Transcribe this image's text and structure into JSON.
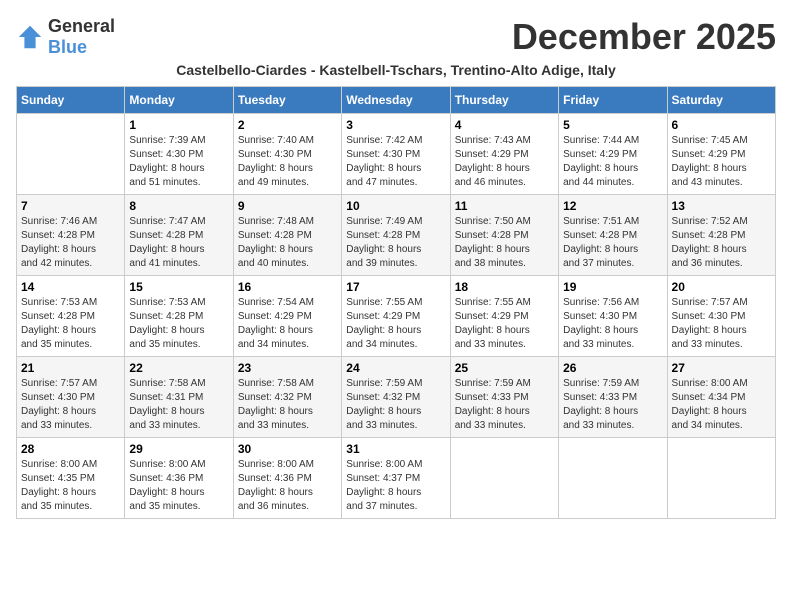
{
  "logo": {
    "general": "General",
    "blue": "Blue"
  },
  "title": "December 2025",
  "subtitle": "Castelbello-Ciardes - Kastelbell-Tschars, Trentino-Alto Adige, Italy",
  "days_of_week": [
    "Sunday",
    "Monday",
    "Tuesday",
    "Wednesday",
    "Thursday",
    "Friday",
    "Saturday"
  ],
  "weeks": [
    [
      {
        "day": "",
        "info": ""
      },
      {
        "day": "1",
        "info": "Sunrise: 7:39 AM\nSunset: 4:30 PM\nDaylight: 8 hours\nand 51 minutes."
      },
      {
        "day": "2",
        "info": "Sunrise: 7:40 AM\nSunset: 4:30 PM\nDaylight: 8 hours\nand 49 minutes."
      },
      {
        "day": "3",
        "info": "Sunrise: 7:42 AM\nSunset: 4:30 PM\nDaylight: 8 hours\nand 47 minutes."
      },
      {
        "day": "4",
        "info": "Sunrise: 7:43 AM\nSunset: 4:29 PM\nDaylight: 8 hours\nand 46 minutes."
      },
      {
        "day": "5",
        "info": "Sunrise: 7:44 AM\nSunset: 4:29 PM\nDaylight: 8 hours\nand 44 minutes."
      },
      {
        "day": "6",
        "info": "Sunrise: 7:45 AM\nSunset: 4:29 PM\nDaylight: 8 hours\nand 43 minutes."
      }
    ],
    [
      {
        "day": "7",
        "info": "Sunrise: 7:46 AM\nSunset: 4:28 PM\nDaylight: 8 hours\nand 42 minutes."
      },
      {
        "day": "8",
        "info": "Sunrise: 7:47 AM\nSunset: 4:28 PM\nDaylight: 8 hours\nand 41 minutes."
      },
      {
        "day": "9",
        "info": "Sunrise: 7:48 AM\nSunset: 4:28 PM\nDaylight: 8 hours\nand 40 minutes."
      },
      {
        "day": "10",
        "info": "Sunrise: 7:49 AM\nSunset: 4:28 PM\nDaylight: 8 hours\nand 39 minutes."
      },
      {
        "day": "11",
        "info": "Sunrise: 7:50 AM\nSunset: 4:28 PM\nDaylight: 8 hours\nand 38 minutes."
      },
      {
        "day": "12",
        "info": "Sunrise: 7:51 AM\nSunset: 4:28 PM\nDaylight: 8 hours\nand 37 minutes."
      },
      {
        "day": "13",
        "info": "Sunrise: 7:52 AM\nSunset: 4:28 PM\nDaylight: 8 hours\nand 36 minutes."
      }
    ],
    [
      {
        "day": "14",
        "info": "Sunrise: 7:53 AM\nSunset: 4:28 PM\nDaylight: 8 hours\nand 35 minutes."
      },
      {
        "day": "15",
        "info": "Sunrise: 7:53 AM\nSunset: 4:28 PM\nDaylight: 8 hours\nand 35 minutes."
      },
      {
        "day": "16",
        "info": "Sunrise: 7:54 AM\nSunset: 4:29 PM\nDaylight: 8 hours\nand 34 minutes."
      },
      {
        "day": "17",
        "info": "Sunrise: 7:55 AM\nSunset: 4:29 PM\nDaylight: 8 hours\nand 34 minutes."
      },
      {
        "day": "18",
        "info": "Sunrise: 7:55 AM\nSunset: 4:29 PM\nDaylight: 8 hours\nand 33 minutes."
      },
      {
        "day": "19",
        "info": "Sunrise: 7:56 AM\nSunset: 4:30 PM\nDaylight: 8 hours\nand 33 minutes."
      },
      {
        "day": "20",
        "info": "Sunrise: 7:57 AM\nSunset: 4:30 PM\nDaylight: 8 hours\nand 33 minutes."
      }
    ],
    [
      {
        "day": "21",
        "info": "Sunrise: 7:57 AM\nSunset: 4:30 PM\nDaylight: 8 hours\nand 33 minutes."
      },
      {
        "day": "22",
        "info": "Sunrise: 7:58 AM\nSunset: 4:31 PM\nDaylight: 8 hours\nand 33 minutes."
      },
      {
        "day": "23",
        "info": "Sunrise: 7:58 AM\nSunset: 4:32 PM\nDaylight: 8 hours\nand 33 minutes."
      },
      {
        "day": "24",
        "info": "Sunrise: 7:59 AM\nSunset: 4:32 PM\nDaylight: 8 hours\nand 33 minutes."
      },
      {
        "day": "25",
        "info": "Sunrise: 7:59 AM\nSunset: 4:33 PM\nDaylight: 8 hours\nand 33 minutes."
      },
      {
        "day": "26",
        "info": "Sunrise: 7:59 AM\nSunset: 4:33 PM\nDaylight: 8 hours\nand 33 minutes."
      },
      {
        "day": "27",
        "info": "Sunrise: 8:00 AM\nSunset: 4:34 PM\nDaylight: 8 hours\nand 34 minutes."
      }
    ],
    [
      {
        "day": "28",
        "info": "Sunrise: 8:00 AM\nSunset: 4:35 PM\nDaylight: 8 hours\nand 35 minutes."
      },
      {
        "day": "29",
        "info": "Sunrise: 8:00 AM\nSunset: 4:36 PM\nDaylight: 8 hours\nand 35 minutes."
      },
      {
        "day": "30",
        "info": "Sunrise: 8:00 AM\nSunset: 4:36 PM\nDaylight: 8 hours\nand 36 minutes."
      },
      {
        "day": "31",
        "info": "Sunrise: 8:00 AM\nSunset: 4:37 PM\nDaylight: 8 hours\nand 37 minutes."
      },
      {
        "day": "",
        "info": ""
      },
      {
        "day": "",
        "info": ""
      },
      {
        "day": "",
        "info": ""
      }
    ]
  ]
}
